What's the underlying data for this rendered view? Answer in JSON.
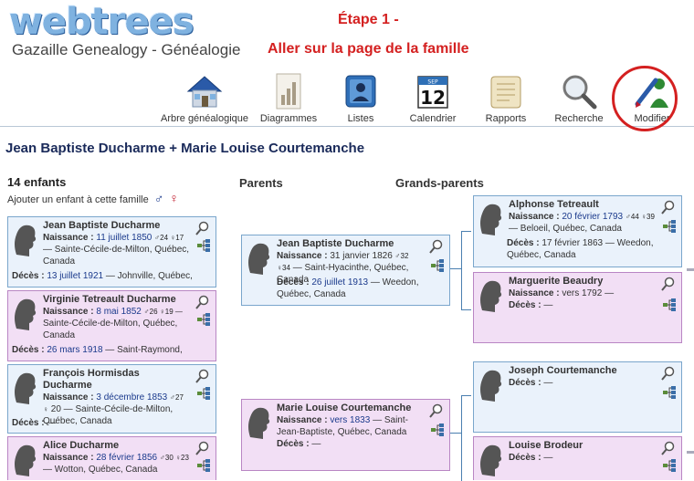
{
  "header": {
    "logo": "webtrees",
    "site_title": "Gazaille Genealogy - Généalogie",
    "step_label": "Étape 1 -",
    "step_text": "Aller sur la page de la famille"
  },
  "menu": [
    {
      "label": "Arbre généalogique",
      "icon": "house-icon"
    },
    {
      "label": "Diagrammes",
      "icon": "chart-icon"
    },
    {
      "label": "Listes",
      "icon": "list-icon"
    },
    {
      "label": "Calendrier",
      "icon": "calendar-icon"
    },
    {
      "label": "Rapports",
      "icon": "scroll-icon"
    },
    {
      "label": "Recherche",
      "icon": "magnifier-icon"
    },
    {
      "label": "Modifier",
      "icon": "edit-icon"
    }
  ],
  "calendar_day": "12",
  "calendar_month": "SEP",
  "family": {
    "title": "Jean Baptiste Ducharme + Marie Louise Courtemanche",
    "children_count": "14 enfants",
    "add_child": "Ajouter un enfant à cette famille",
    "male_symbol": "♂",
    "female_symbol": "♀",
    "parents_heading": "Parents",
    "grandparents_heading": "Grands-parents"
  },
  "labels": {
    "birth": "Naissance :",
    "death": "Décès :"
  },
  "children": [
    {
      "name": "Jean Baptiste Ducharme",
      "birth_date": "11 juillet 1850",
      "ages": "♂24 ♀17",
      "birth_place": "— Sainte-Cécile-de-Milton, Québec, Canada",
      "death_date": "13 juillet 1921",
      "death_place": "— Johnville, Québec,"
    },
    {
      "name": "Virginie Tetreault Ducharme",
      "birth_date": "8 mai 1852",
      "ages": "♂26 ♀19 —",
      "birth_place": "Sainte-Cécile-de-Milton, Québec, Canada",
      "death_date": "26 mars 1918",
      "death_place": "— Saint-Raymond,"
    },
    {
      "name": "François Hormisdas Ducharme",
      "birth_date": "3 décembre 1853",
      "ages": "♂27 ♀",
      "birth_place": "20 — Sainte-Cécile-de-Milton, Québec, Canada",
      "death_date": "",
      "death_place": "—"
    },
    {
      "name": "Alice Ducharme",
      "birth_date": "28 février 1856",
      "ages": "♂30 ♀23",
      "birth_place": "— Wotton, Québec, Canada",
      "death_date": "",
      "death_place": ""
    }
  ],
  "parents": [
    {
      "name": "Jean Baptiste Ducharme",
      "birth_date": "31 janvier 1826",
      "ages": "♂32 ♀34",
      "birth_place": "— Saint-Hyacinthe, Québec, Canada",
      "death_date": "26 juillet 1913",
      "death_place": "— Weedon, Québec, Canada"
    },
    {
      "name": "Marie Louise Courtemanche",
      "birth_date": "vers 1833",
      "ages": "",
      "birth_place": "— Saint-Jean-Baptiste, Québec, Canada",
      "death_date": "",
      "death_place": "—"
    }
  ],
  "grandparents": [
    {
      "name": "Alphonse Tetreault",
      "birth_date": "20 février 1793",
      "ages": "♂44 ♀39",
      "birth_place": "— Beloeil, Québec, Canada",
      "death_date": "17 février 1863",
      "death_place": "— Weedon, Québec, Canada"
    },
    {
      "name": "Marguerite Beaudry",
      "birth_date": "vers 1792",
      "ages": "",
      "birth_place": "—",
      "death_date": "",
      "death_place": "—"
    },
    {
      "name": "Joseph Courtemanche",
      "birth_date": "",
      "ages": "",
      "birth_place": "",
      "death_date": "",
      "death_place": "—"
    },
    {
      "name": "Louise Brodeur",
      "birth_date": "",
      "ages": "",
      "birth_place": "",
      "death_date": "",
      "death_place": "—"
    }
  ],
  "colors": {
    "accent_red": "#d42020",
    "male_bg": "#eaf2fb",
    "female_bg": "#f2dff5",
    "male_symbol": "#1b3a8c",
    "female_symbol": "#c0182a"
  }
}
